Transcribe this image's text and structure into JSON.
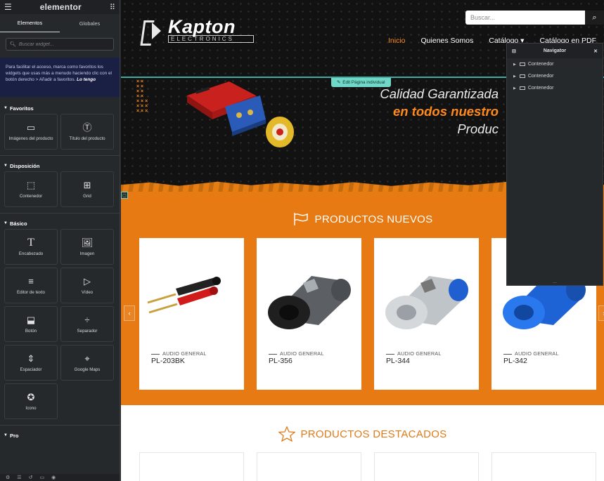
{
  "panel": {
    "logo": "elementor",
    "tabs": [
      "Elementos",
      "Globales"
    ],
    "search_placeholder": "Buscar widget...",
    "notice_text": "Para facilitar el acceso, marca como favoritos los widgets que usas más a menudo haciendo clic con el botón derecho > Añadir a favoritos.",
    "notice_action": "Lo tengo",
    "categories": [
      {
        "title": "Favoritos",
        "widgets": [
          {
            "label": "Imágenes del producto",
            "icon": "product-images-icon"
          },
          {
            "label": "Título del producto",
            "icon": "product-title-icon"
          }
        ]
      },
      {
        "title": "Disposición",
        "widgets": [
          {
            "label": "Contenedor",
            "icon": "container-icon"
          },
          {
            "label": "Grid",
            "icon": "grid-icon"
          }
        ]
      },
      {
        "title": "Básico",
        "widgets": [
          {
            "label": "Encabezado",
            "icon": "heading-icon"
          },
          {
            "label": "Imagen",
            "icon": "image-icon"
          },
          {
            "label": "Editor de texto",
            "icon": "text-editor-icon"
          },
          {
            "label": "Vídeo",
            "icon": "video-icon"
          },
          {
            "label": "Botón",
            "icon": "button-icon"
          },
          {
            "label": "Separador",
            "icon": "divider-icon"
          },
          {
            "label": "Espaciador",
            "icon": "spacer-icon"
          },
          {
            "label": "Google Maps",
            "icon": "google-maps-icon"
          },
          {
            "label": "Icono",
            "icon": "star-icon"
          }
        ]
      },
      {
        "title": "Pro",
        "widgets": []
      }
    ]
  },
  "site": {
    "search_placeholder": "Buscar...",
    "brand": "Kapton",
    "brand_sub": "ELECTRONICS",
    "nav": [
      "Inicio",
      "Quienes Somos",
      "Catálogo ▾",
      "Catálogo en PDF"
    ],
    "edit_tab": "Edit Página individual",
    "hero_line1": "Calidad Garantizada",
    "hero_line2": "en todos nuestro",
    "hero_line3": "Produc",
    "section1_title": "PRODUCTOS NUEVOS",
    "products": [
      {
        "category": "AUDIO GENERAL",
        "name": "PL-203BK"
      },
      {
        "category": "AUDIO GENERAL",
        "name": "PL-356"
      },
      {
        "category": "AUDIO GENERAL",
        "name": "PL-344"
      },
      {
        "category": "AUDIO GENERAL",
        "name": "PL-342"
      }
    ],
    "section2_title": "PRODUCTOS DESTACADOS",
    "colors": {
      "accent": "#e77a12",
      "panel": "#26292c",
      "highlight": "#71d7c6"
    }
  },
  "navigator": {
    "title": "Navigator",
    "items": [
      "Contenedor",
      "Contenedor",
      "Contenedor"
    ]
  }
}
